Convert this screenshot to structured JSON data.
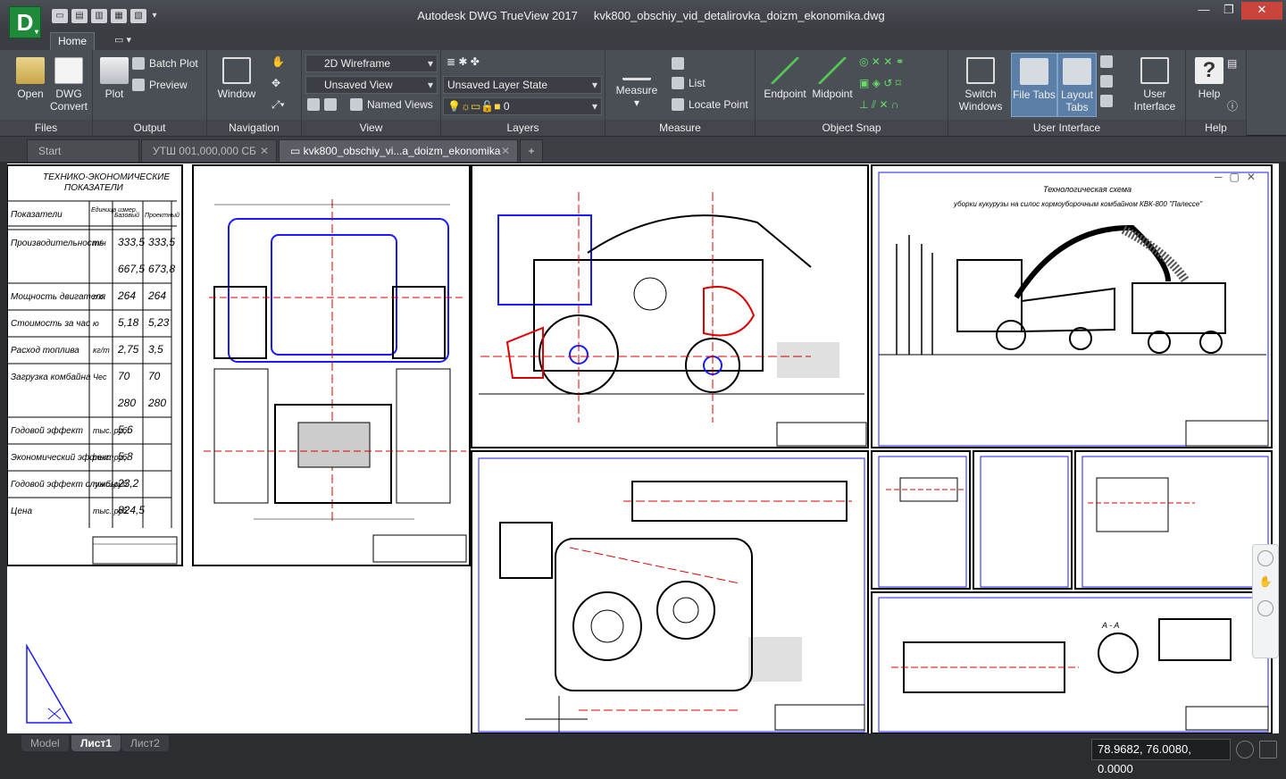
{
  "app": {
    "logo_letter": "D",
    "title": "Autodesk DWG TrueView 2017",
    "filename": "kvk800_obschiy_vid_detalirovka_doizm_ekonomika.dwg"
  },
  "ribbon": {
    "tab_home": "Home",
    "panels": {
      "files": {
        "label": "Files",
        "open": "Open",
        "dwg_convert_1": "DWG",
        "dwg_convert_2": "Convert"
      },
      "output": {
        "label": "Output",
        "plot": "Plot",
        "batch_plot": "Batch Plot",
        "preview": "Preview"
      },
      "navigation": {
        "label": "Navigation",
        "window": "Window"
      },
      "view": {
        "label": "View",
        "visual_style": "2D Wireframe",
        "named_view": "Unsaved View",
        "named_views": "Named Views"
      },
      "layers": {
        "label": "Layers",
        "layer_state": "Unsaved Layer State",
        "current_layer": "0"
      },
      "measure": {
        "label": "Measure",
        "measure": "Measure",
        "list": "List",
        "locate_point": "Locate Point"
      },
      "object_snap": {
        "label": "Object Snap",
        "endpoint": "Endpoint",
        "midpoint": "Midpoint"
      },
      "user_interface": {
        "label": "User Interface",
        "switch_1": "Switch",
        "switch_2": "Windows",
        "file_tabs": "File Tabs",
        "layout_1": "Layout",
        "layout_2": "Tabs",
        "user_1": "User",
        "user_2": "Interface"
      },
      "help": {
        "label": "Help",
        "help": "Help"
      }
    }
  },
  "doc_tabs": [
    "Start",
    "УТШ 001,000,000 СБ",
    "kvk800_obschiy_vi...a_doizm_ekonomika"
  ],
  "layout_tabs": [
    "Model",
    "Лист1",
    "Лист2"
  ],
  "coordinates": "78.9682, 76.0080, 0.0000",
  "drawing": {
    "table_title_1": "ТЕХНИКО-ЭКОНОМИЧЕСКИЕ",
    "table_title_2": "ПОКАЗАТЕЛИ",
    "table_header": [
      "Показатели",
      "Единица измер.",
      "Базовый",
      "Проектный"
    ],
    "table_rows": [
      {
        "label": "Производительность",
        "unit": "т/ч",
        "base": "333,5",
        "proj": "333,5"
      },
      {
        "label": "",
        "unit": "",
        "base": "667,5",
        "proj": "673,8"
      },
      {
        "label": "Мощность двигателя",
        "unit": "л.с.",
        "base": "264",
        "proj": "264"
      },
      {
        "label": "Стоимость за час",
        "unit": "ю",
        "base": "5,18",
        "proj": "5,23"
      },
      {
        "label": "Расход топлива",
        "unit": "кг/т",
        "base": "2,75",
        "proj": "3,5"
      },
      {
        "label": "Загрузка комбайна",
        "unit": "Чес",
        "base": "70",
        "proj": "70"
      },
      {
        "label": "",
        "unit": "",
        "base": "280",
        "proj": "280"
      },
      {
        "label": "Годовой эффект",
        "unit": "тыс. руб.",
        "base": "5,6",
        "proj": ""
      },
      {
        "label": "Экономический эффект",
        "unit": "тыс. руб.",
        "base": "5,8",
        "proj": ""
      },
      {
        "label": "Годовой эффект службы",
        "unit": "тыс. руб.",
        "base": "23,2",
        "proj": ""
      },
      {
        "label": "Цена",
        "unit": "тыс. руб.",
        "base": "824,5",
        "proj": ""
      }
    ],
    "scheme_title_1": "Технологическая схема",
    "scheme_title_2": "уборки кукурузы на силос кормоуборочным комбайном КВК-800 \"Палессе\"",
    "section_label": "A - A"
  }
}
